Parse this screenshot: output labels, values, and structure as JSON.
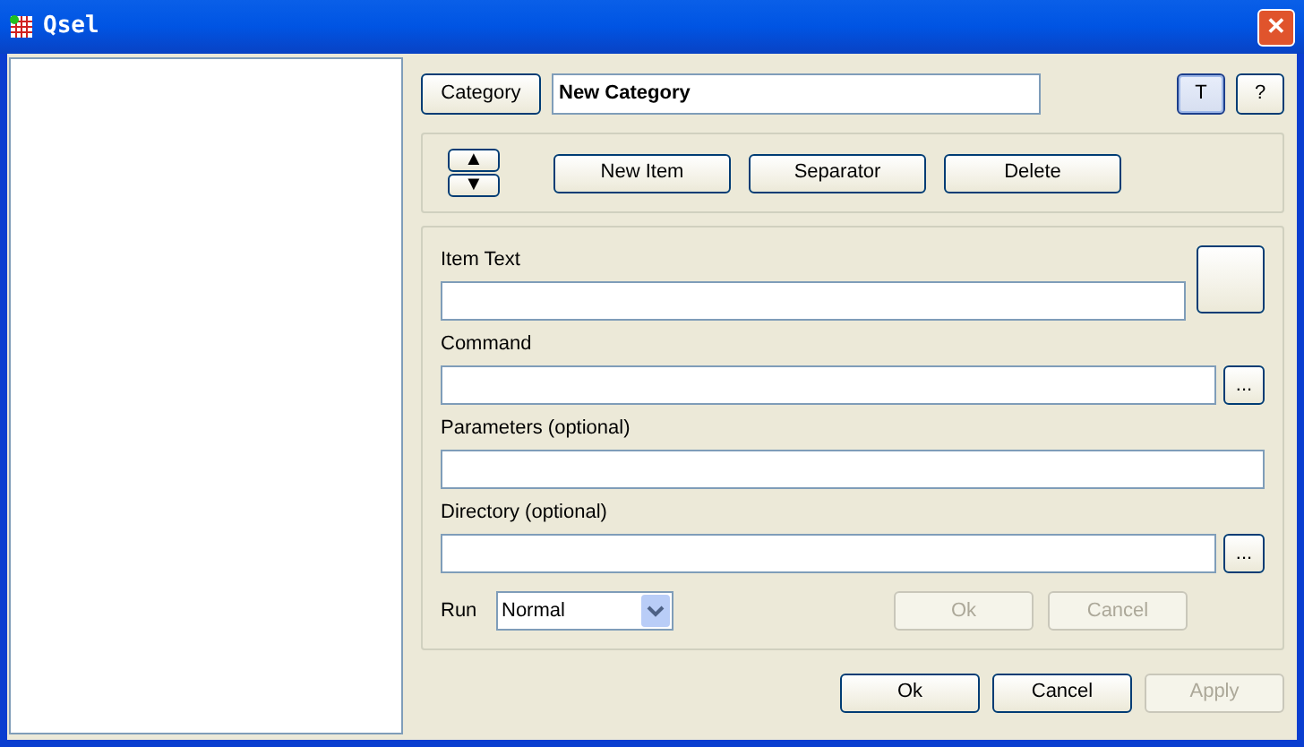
{
  "window": {
    "title": "Qsel",
    "close": "✕"
  },
  "category": {
    "button": "Category",
    "value": "New Category"
  },
  "top_buttons": [
    {
      "label": "T",
      "selected": true
    },
    {
      "label": "?",
      "selected": false
    }
  ],
  "move_buttons": [
    "▲",
    "▼"
  ],
  "item_buttons": [
    {
      "label": "New Item"
    },
    {
      "label": "Separator"
    },
    {
      "label": "Delete"
    }
  ],
  "fields": [
    {
      "label": "Item Text",
      "kind": "icon"
    },
    {
      "label": "Command",
      "kind": "browse",
      "browse": "..."
    },
    {
      "label": "Parameters (optional)",
      "kind": "plain"
    },
    {
      "label": "Directory (optional)",
      "kind": "browse",
      "browse": "..."
    }
  ],
  "run": {
    "label": "Run",
    "value": "Normal"
  },
  "item_actions": [
    {
      "label": "Ok",
      "disabled": true
    },
    {
      "label": "Cancel",
      "disabled": true
    }
  ],
  "dialog_buttons": [
    {
      "label": "Ok",
      "disabled": false
    },
    {
      "label": "Cancel",
      "disabled": false
    },
    {
      "label": "Apply",
      "disabled": true
    }
  ]
}
